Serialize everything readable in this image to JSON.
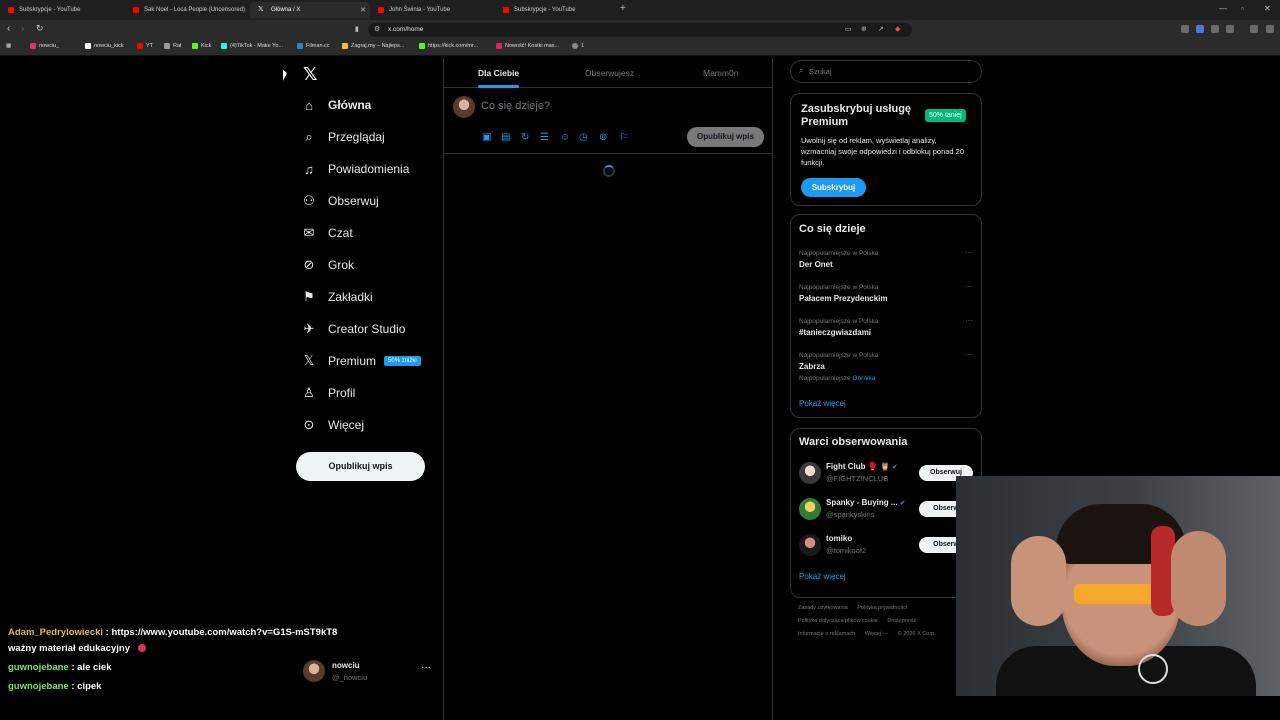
{
  "browser": {
    "tabs": [
      {
        "title": "Subskrypcje - YouTube",
        "icon": "youtube-icon"
      },
      {
        "title": "Sak Noel - Loca People (Uncensored)",
        "icon": "youtube-icon"
      },
      {
        "title": "Główna / X",
        "icon": "x-icon"
      },
      {
        "title": "John Świnia - YouTube",
        "icon": "youtube-icon"
      },
      {
        "title": "Subskrypcje - YouTube",
        "icon": "youtube-icon"
      }
    ],
    "url": "x.com/home",
    "bookmarks": [
      "nowciu_",
      "nowciu_kick",
      "YT",
      "Rat",
      "Kick",
      "(4)TikTok - Make Yo...",
      "Filman.cc",
      "Zagraj.my – Najleps...",
      "https://kick.com/mr...",
      "Nowość! Kostki mas...",
      "1"
    ]
  },
  "sidebar": {
    "items": [
      {
        "label": "Główna",
        "icon": "home-icon"
      },
      {
        "label": "Przeglądaj",
        "icon": "search-icon"
      },
      {
        "label": "Powiadomienia",
        "icon": "bell-icon"
      },
      {
        "label": "Obserwuj",
        "icon": "follow-icon"
      },
      {
        "label": "Czat",
        "icon": "mail-icon"
      },
      {
        "label": "Grok",
        "icon": "grok-icon"
      },
      {
        "label": "Zakładki",
        "icon": "bookmark-icon"
      },
      {
        "label": "Creator Studio",
        "icon": "rocket-icon"
      },
      {
        "label": "Premium",
        "icon": "x-premium-icon"
      },
      {
        "label": "Profil",
        "icon": "person-icon"
      },
      {
        "label": "Więcej",
        "icon": "more-circle-icon"
      }
    ],
    "premium_badge": "50% zniżki",
    "publish_label": "Opublikuj wpis",
    "account": {
      "name": "nowciu",
      "handle": "@_nowciu"
    }
  },
  "main": {
    "tabs": [
      "Dla Ciebie",
      "Obserwujesz",
      "Mamm0n"
    ],
    "compose_placeholder": "Co się dzieje?",
    "publish_label": "Opublikuj wpis"
  },
  "right": {
    "search_placeholder": "Szukaj",
    "premium": {
      "title": "Zasubskrybuj usługę Premium",
      "badge": "50% taniej",
      "desc": "Uwolnij się od reklam, wyświetlaj analizy, wzmacniaj swoje odpowiedzi i odblokuj ponad 20 funkcji.",
      "button": "Subskrybuj"
    },
    "trends": {
      "title": "Co się dzieje",
      "items": [
        {
          "context": "Najpopularniejsze w Polska",
          "name": "Der Onet"
        },
        {
          "context": "Najpopularniejsze w Polska",
          "name": "Pałacem Prezydenckim"
        },
        {
          "context": "Najpopularniejsze w Polska",
          "name": "#tanieczgwiazdami"
        },
        {
          "context": "Najpopularniejsze w Polska",
          "name": "Zabrza",
          "sub_prefix": "Najpopularniejsze",
          "sub_highlight": "Górnika"
        }
      ],
      "show_more": "Pokaż więcej"
    },
    "follow": {
      "title": "Warci obserwowania",
      "items": [
        {
          "name": "Fight Club 🥊 🦉",
          "handle": "@FIGHTZINCLUB",
          "button": "Obserwuj"
        },
        {
          "name": "Spanky - Buying ...",
          "handle": "@spankyskins",
          "button": "Obserw"
        },
        {
          "name": "tomiko",
          "handle": "@tomikoof2",
          "button": "Obserw"
        }
      ],
      "show_more": "Pokaż więcej"
    },
    "footer": [
      "Zasady użytkowania",
      "Polityka prywatności",
      "Polityka dotycząca plików cookie",
      "Dostępność",
      "Informacje o reklamach",
      "Więcej ···",
      "© 2026 X Corp."
    ]
  },
  "chat": [
    {
      "user": "Adam_Pedrylowiecki",
      "message": "https://www.youtube.com/watch?v=G1S-mST9kT8"
    },
    {
      "user": "",
      "message": "ważny materiał edukacyjny"
    },
    {
      "user": "guwnojebane",
      "message": "ale ciek"
    },
    {
      "user": "guwnojebane",
      "message": "cipek"
    }
  ],
  "colors": {
    "accent": "#1d9bf0",
    "background": "#000000",
    "premium_green": "#00ba7c"
  }
}
